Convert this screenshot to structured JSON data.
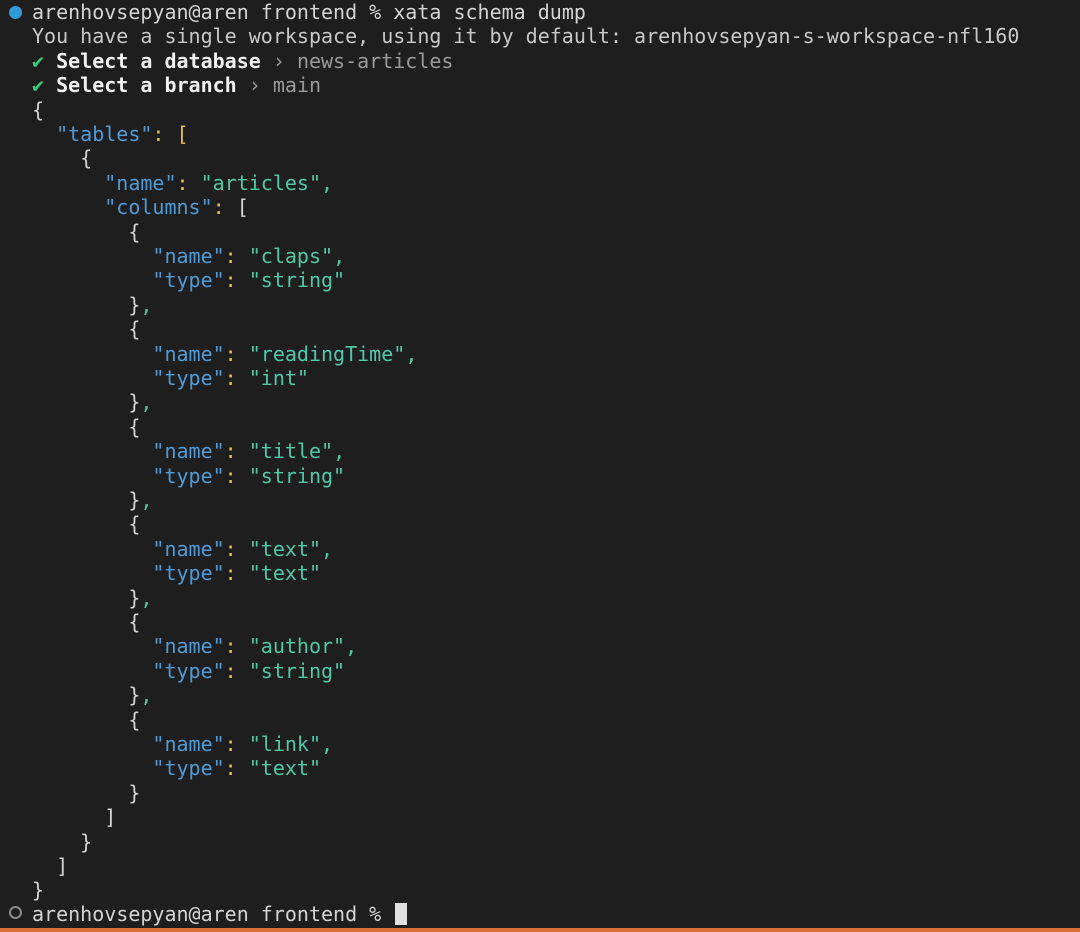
{
  "prompt": {
    "user_host": "arenhovsepyan@aren",
    "cwd": "frontend",
    "symbol": "%",
    "command": "xata schema dump"
  },
  "workspace_message": "You have a single workspace, using it by default: arenhovsepyan-s-workspace-nfl160",
  "selections": [
    {
      "check": "✔",
      "label": "Select a database",
      "arrow": "›",
      "value": "news-articles"
    },
    {
      "check": "✔",
      "label": "Select a branch",
      "arrow": "›",
      "value": "main"
    }
  ],
  "schema": {
    "tables_key": "tables",
    "table_name": "articles",
    "columns_key": "columns",
    "name_key": "name",
    "type_key": "type",
    "columns": [
      {
        "name": "claps",
        "type": "string"
      },
      {
        "name": "readingTime",
        "type": "int"
      },
      {
        "name": "title",
        "type": "string"
      },
      {
        "name": "text",
        "type": "text"
      },
      {
        "name": "author",
        "type": "string"
      },
      {
        "name": "link",
        "type": "text"
      }
    ]
  },
  "colors": {
    "background": "#1e1e1e",
    "key": "#4f9bd8",
    "string": "#4ec9a7",
    "colon": "#e3c14b",
    "check": "#37c87a",
    "accent_border": "#d9703a"
  }
}
